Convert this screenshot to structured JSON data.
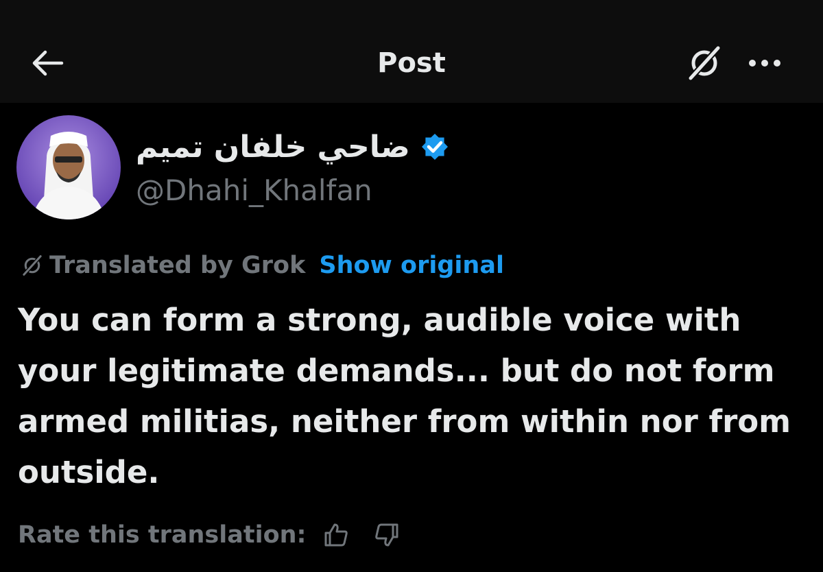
{
  "header": {
    "title": "Post",
    "back_icon": "arrow-left-icon",
    "grok_icon": "grok-icon",
    "more_icon": "more-horizontal-icon"
  },
  "author": {
    "display_name": "ضاحي خلفان تميم",
    "handle": "@Dhahi_Khalfan",
    "verified": true,
    "verified_color": "#1d9bf0"
  },
  "translation": {
    "label": "Translated by Grok",
    "show_original": "Show original"
  },
  "post": {
    "text": "You can form a strong, audible voice with your legitimate demands... but do not form armed militias, neither from within nor from outside."
  },
  "rating": {
    "label": "Rate this translation:",
    "thumbs_up_icon": "thumbs-up-icon",
    "thumbs_down_icon": "thumbs-down-icon"
  },
  "colors": {
    "background": "#000000",
    "header_background": "#0d0d0d",
    "text_primary": "#e7e9ea",
    "text_secondary": "#71767b",
    "accent": "#1d9bf0"
  }
}
